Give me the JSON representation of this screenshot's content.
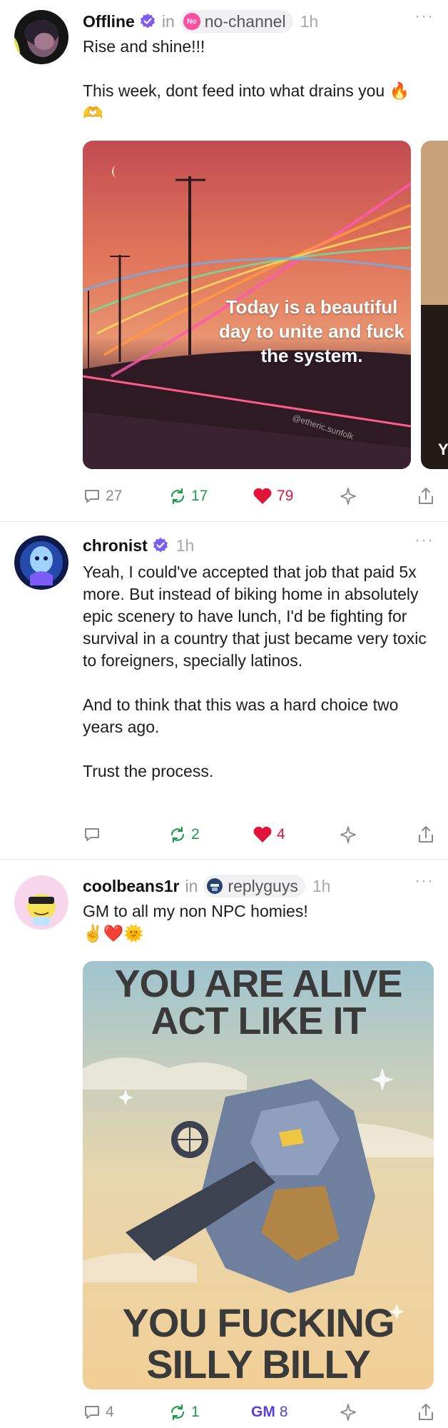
{
  "posts": [
    {
      "username": "Offline",
      "in_word": "in",
      "channel": "no-channel",
      "channel_icon_text": "No",
      "timestamp": "1h",
      "text": "Rise and shine!!!\n\nThis week, dont feed into what drains you 🔥\n🫶",
      "image_caption": "Today is a beautiful day to unite and fuck the system.",
      "image_watermark": "@etheric.sunfolk",
      "partial_image_letter": "Y",
      "replies": "27",
      "recasts": "17",
      "likes": "79"
    },
    {
      "username": "chronist",
      "timestamp": "1h",
      "text": "Yeah, I could've accepted that job that paid 5x more. But instead of biking home in absolutely epic scenery to have lunch, I'd be fighting for survival in a country that just became very toxic to foreigners, specially latinos.\n\nAnd to think that this was a hard choice two years ago.\n\nTrust the process.",
      "replies": "",
      "recasts": "2",
      "likes": "4"
    },
    {
      "username": "coolbeans1r",
      "in_word": "in",
      "channel": "replyguys",
      "timestamp": "1h",
      "text": "GM to all my non NPC homies!\n✌️❤️🌞",
      "poster_top_1": "YOU ARE ALIVE",
      "poster_top_2": "ACT LIKE IT",
      "poster_bottom_1": "YOU FUCKING",
      "poster_bottom_2": "SILLY BILLY",
      "replies": "4",
      "recasts": "1",
      "gm_label": "GM",
      "gm_count": "8"
    }
  ],
  "more_glyph": "···",
  "colors": {
    "verified": "#7c5cf5",
    "recast": "#1f9a4a",
    "like": "#e0153a",
    "gm": "#5c3fd6"
  },
  "icons": [
    "more-icon",
    "verified-icon",
    "reply-icon",
    "recast-icon",
    "heart-icon",
    "star-icon",
    "share-icon"
  ]
}
